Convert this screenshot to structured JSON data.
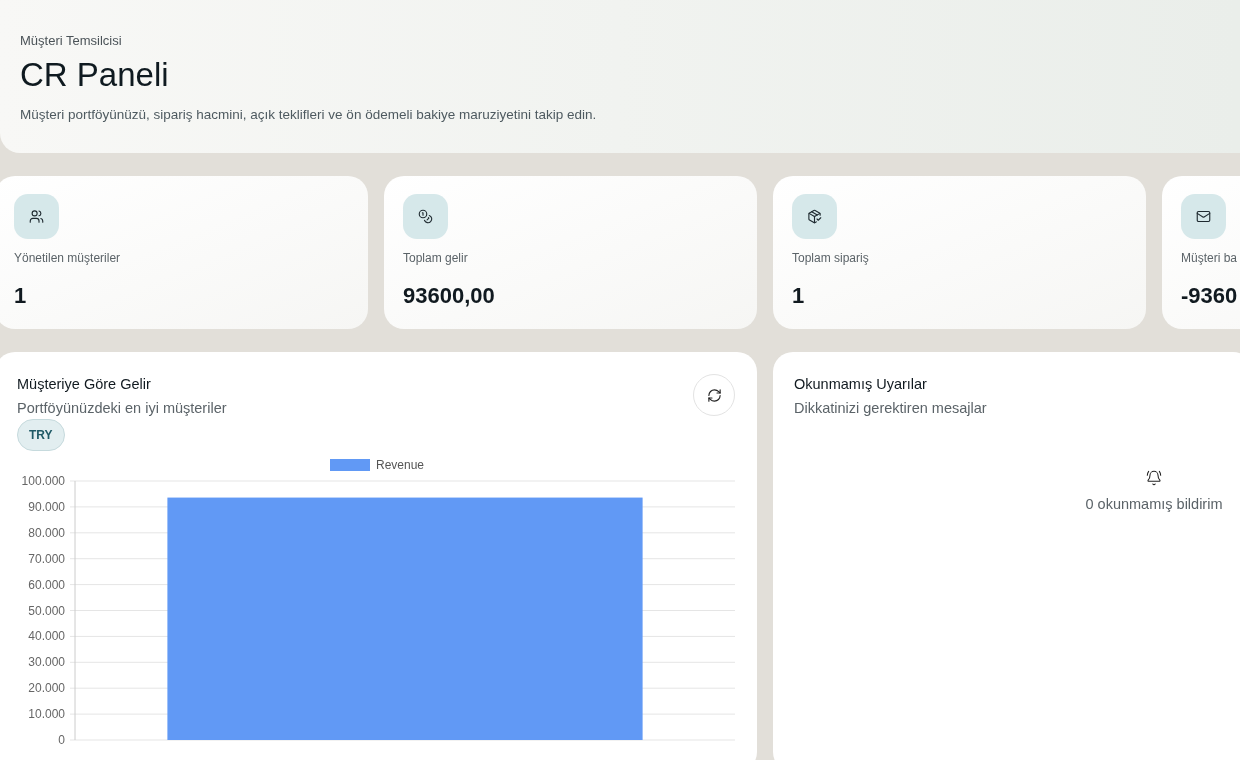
{
  "header": {
    "eyebrow": "Müşteri Temsilcisi",
    "title": "CR Paneli",
    "description": "Müşteri portföyünüzü, sipariş hacmini, açık teklifleri ve ön ödemeli bakiye maruziyetini takip edin."
  },
  "stats": [
    {
      "kind": "customers",
      "label": "Yönetilen müşteriler",
      "value": "1"
    },
    {
      "kind": "revenue",
      "label": "Toplam gelir",
      "value": "93600,00"
    },
    {
      "kind": "orders",
      "label": "Toplam sipariş",
      "value": "1"
    },
    {
      "kind": "balance",
      "label": "Müşteri ba",
      "value": "-9360"
    }
  ],
  "revenue_panel": {
    "title": "Müşteriye Göre Gelir",
    "subtitle": "Portföyünüzdeki en iyi müşteriler",
    "currency": "TRY",
    "chart_data": {
      "type": "bar",
      "grid": true,
      "series": [
        {
          "name": "Revenue",
          "color": "#6199f5",
          "values": [
            93600
          ]
        }
      ],
      "ylim": [
        0,
        100000
      ],
      "yticks": [
        {
          "value": 0,
          "label": "0"
        },
        {
          "value": 10000,
          "label": "10.000"
        },
        {
          "value": 20000,
          "label": "20.000"
        },
        {
          "value": 30000,
          "label": "30.000"
        },
        {
          "value": 40000,
          "label": "40.000"
        },
        {
          "value": 50000,
          "label": "50.000"
        },
        {
          "value": 60000,
          "label": "60.000"
        },
        {
          "value": 70000,
          "label": "70.000"
        },
        {
          "value": 80000,
          "label": "80.000"
        },
        {
          "value": 90000,
          "label": "90.000"
        },
        {
          "value": 100000,
          "label": "100.000"
        }
      ]
    }
  },
  "alerts_panel": {
    "title": "Okunmamış Uyarılar",
    "subtitle": "Dikkatinizi gerektiren mesajlar",
    "empty_text": "0 okunmamış bildirim"
  }
}
